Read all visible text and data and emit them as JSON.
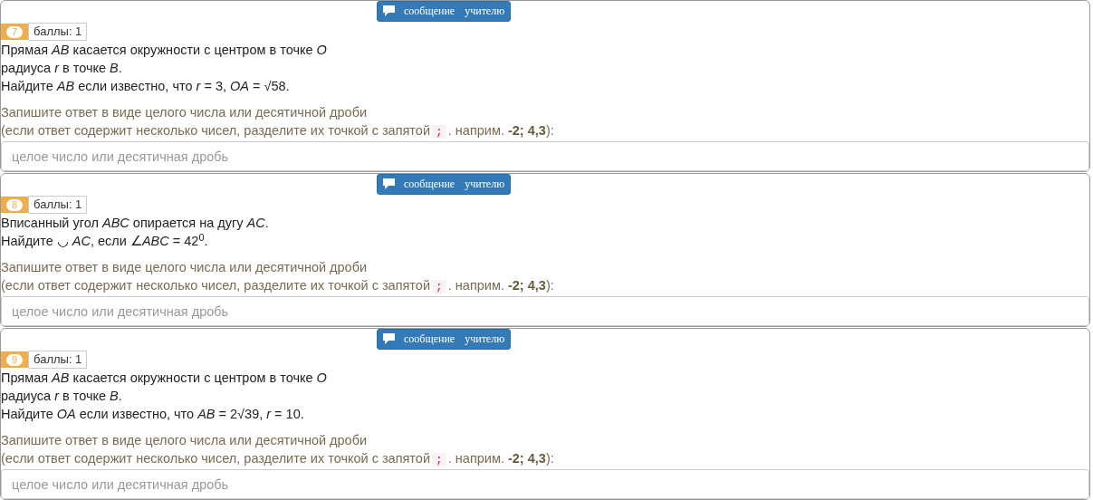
{
  "tasks": [
    {
      "number": "7",
      "points": "баллы: 1",
      "message_button": "сообщение учителю",
      "question": [
        "Прямая *AB* касается окружности с центром в точке *O*",
        "радиуса *r* в точке *B*.",
        "Найдите *AB* если известно, что *r* = 3, *OA* = √58."
      ],
      "hint_line": "Запишите ответ в виде целого числа или десятичной дроби",
      "hint_pre": "(если ответ содержит несколько чисел, разделите их точкой с запятой",
      "hint_code": ";",
      "hint_post": ". наприм. **-2; 4,3**):",
      "placeholder": "целое число или десятичная дробь"
    },
    {
      "number": "8",
      "points": "баллы: 1",
      "message_button": "сообщение учителю",
      "question": [
        "Вписанный угол *ABC* опирается на дугу *AC*.",
        "Найдите ◡ *AC*, если ∠*ABC* = 42$^{0}$."
      ],
      "hint_line": "Запишите ответ в виде целого числа или десятичной дроби",
      "hint_pre": "(если ответ содержит несколько чисел, разделите их точкой с запятой",
      "hint_code": ";",
      "hint_post": ". наприм. **-2; 4,3**):",
      "placeholder": "целое число или десятичная дробь"
    },
    {
      "number": "9",
      "points": "баллы: 1",
      "message_button": "сообщение учителю",
      "question": [
        "Прямая *AB* касается окружности с центром в точке *O*",
        "радиуса *r* в точке *B*.",
        "Найдите *OA* если известно, что *AB* = 2√39, *r* = 10."
      ],
      "hint_line": "Запишите ответ в виде целого числа или десятичной дроби",
      "hint_pre": "(если ответ содержит несколько чисел, разделите их точкой с запятой",
      "hint_code": ";",
      "hint_post": ". наприм. **-2; 4,3**):",
      "placeholder": "целое число или десятичная дробь"
    }
  ]
}
